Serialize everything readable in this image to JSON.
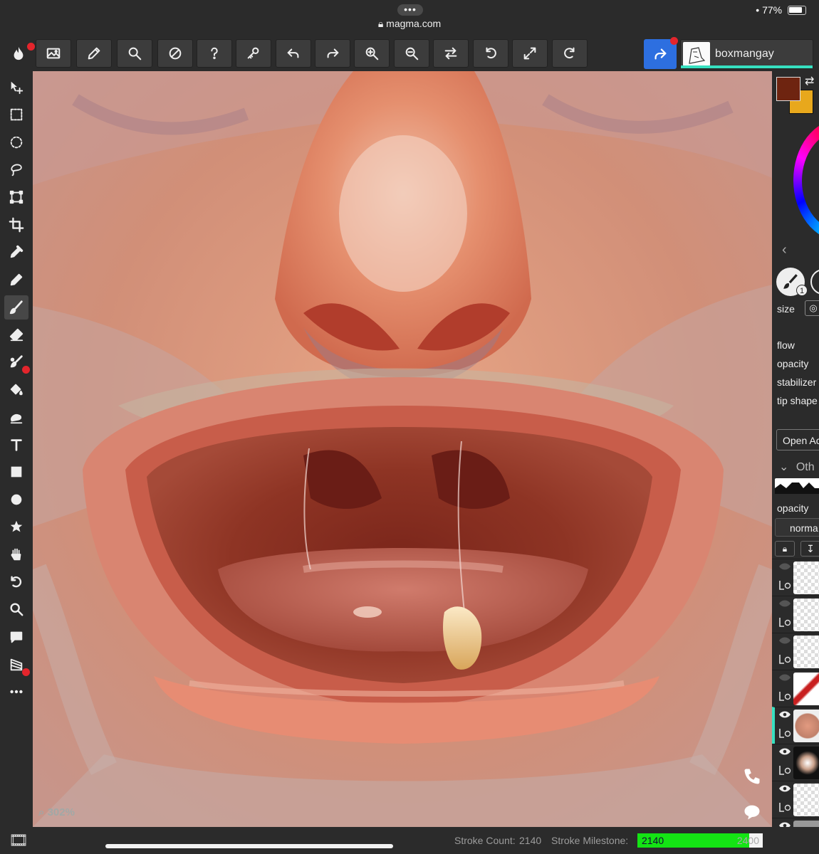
{
  "browser": {
    "url": "magma.com",
    "battery": "77%",
    "more_dots": "•••"
  },
  "toolbar": {
    "buttons": [
      "image-icon",
      "pencil-icon",
      "search-icon",
      "contrast-icon",
      "help-icon",
      "key-icon",
      "undo-icon",
      "redo-icon",
      "zoom-in-icon",
      "zoom-out-icon",
      "swap-icon",
      "rotate-left-icon",
      "fullscreen-icon",
      "rotate-right-icon"
    ],
    "share_icon": "share-icon",
    "username": "boxmangay",
    "accent_color": "#2d6fe0",
    "user_bar_color": "#36e0c0"
  },
  "left_tools": [
    "move-icon",
    "rect-select-icon",
    "ellipse-select-icon",
    "lasso-icon",
    "transform-icon",
    "crop-icon",
    "eyedropper-icon",
    "pencil-icon",
    "brush-icon",
    "eraser-icon",
    "smudge-icon",
    "fill-icon",
    "select-paint-icon",
    "text-icon",
    "rectangle-icon",
    "ellipse-icon",
    "star-icon",
    "hand-icon",
    "rotate-icon",
    "zoom-icon",
    "comment-icon",
    "gradient-icon",
    "more-icon"
  ],
  "canvas": {
    "zoom": "302%"
  },
  "right_panel": {
    "primary_color": "#6e2410",
    "secondary_color": "#e8a81c",
    "brush_badge": "1",
    "size_label": "size",
    "flow_label": "flow",
    "opacity_label": "opacity",
    "stabilizer_label": "stabilizer",
    "tip_shape_label": "tip shape",
    "open_button": "Open Ac",
    "section_title": "Oth",
    "layer_opacity_label": "opacity",
    "blend_mode": "norma"
  },
  "stats": {
    "stroke_count_label": "Stroke Count:",
    "stroke_count": "2140",
    "milestone_label": "Stroke Milestone:",
    "milestone_value": "2140",
    "milestone_goal": "2400",
    "milestone_progress": 0.89
  }
}
